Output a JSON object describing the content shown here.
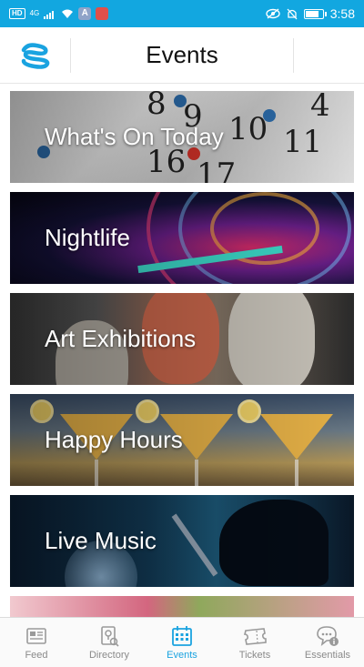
{
  "status_bar": {
    "badge": "HD",
    "network": "4G",
    "time": "3:58",
    "battery_level": 0.85,
    "app_icons": [
      "a-app-icon",
      "home-app-icon"
    ]
  },
  "header": {
    "title": "Events",
    "logo_icon": "stacked-s-logo-icon"
  },
  "events": [
    {
      "label": "What's On Today",
      "image": "calendar-pins"
    },
    {
      "label": "Nightlife",
      "image": "turntable-neon"
    },
    {
      "label": "Art Exhibitions",
      "image": "painted-faces"
    },
    {
      "label": "Happy Hours",
      "image": "cocktail-glasses"
    },
    {
      "label": "Live Music",
      "image": "guitarist-stage"
    },
    {
      "label": "",
      "image": "flowers"
    }
  ],
  "bottom_nav": {
    "items": [
      {
        "label": "Feed",
        "icon": "feed-icon",
        "active": false
      },
      {
        "label": "Directory",
        "icon": "directory-icon",
        "active": false
      },
      {
        "label": "Events",
        "icon": "calendar-icon",
        "active": true
      },
      {
        "label": "Tickets",
        "icon": "ticket-icon",
        "active": false
      },
      {
        "label": "Essentials",
        "icon": "chat-info-icon",
        "active": false
      }
    ]
  },
  "colors": {
    "accent": "#1aa3e0",
    "status_bar": "#12a7e0",
    "nav_inactive": "#8a8a8a"
  }
}
